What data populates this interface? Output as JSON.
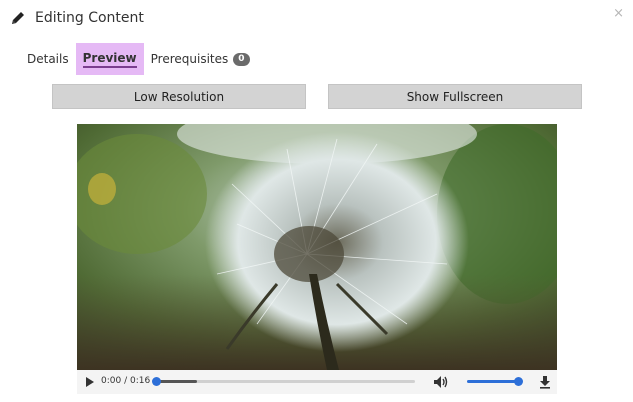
{
  "header": {
    "title": "Editing Content",
    "close_glyph": "×",
    "icon": "pencil-icon"
  },
  "tabs": [
    {
      "label": "Details",
      "active": false
    },
    {
      "label": "Preview",
      "active": true
    },
    {
      "label": "Prerequisites",
      "active": false,
      "badge": "0"
    }
  ],
  "buttons": {
    "low_resolution": "Low Resolution",
    "show_fullscreen": "Show Fullscreen"
  },
  "player": {
    "time": "0:00 / 0:16",
    "progress": 0.0,
    "buffered": 0.16,
    "volume": 1.0,
    "icons": [
      "play-icon",
      "volume-icon",
      "download-icon"
    ]
  },
  "colors": {
    "active_tab_bg": "#e5b9f5",
    "active_tab_underline": "#7a3d8f",
    "slider_accent": "#2d6fd8",
    "button_bg": "#d3d3d3"
  }
}
